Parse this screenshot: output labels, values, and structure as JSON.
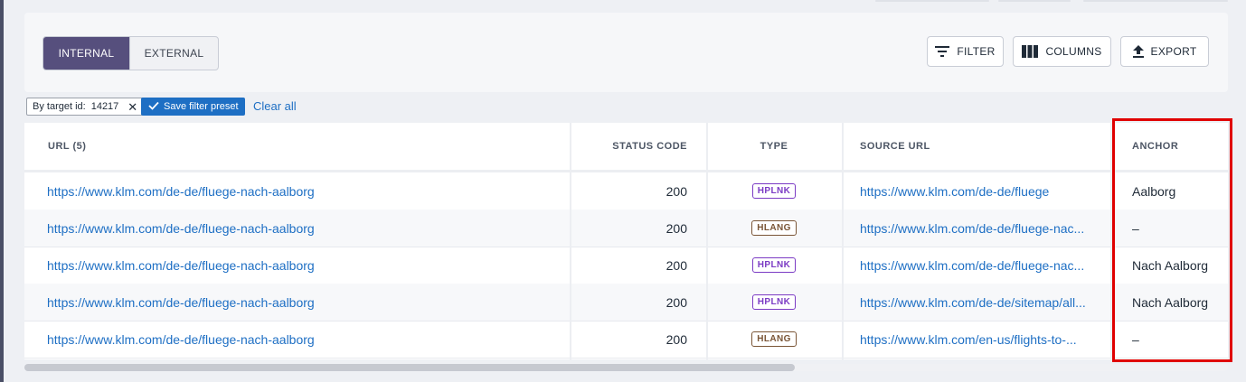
{
  "tabs": [
    {
      "label": "INTERNAL",
      "active": true
    },
    {
      "label": "EXTERNAL",
      "active": false
    }
  ],
  "toolbar": {
    "filter_label": "FILTER",
    "columns_label": "COLUMNS",
    "export_label": "EXPORT",
    "icons": [
      "filter-icon",
      "columns-icon",
      "export-icon"
    ]
  },
  "filters": {
    "chip_label": "By target id:",
    "chip_value": "14217",
    "save_preset_label": "Save filter preset",
    "clear_all_label": "Clear all"
  },
  "table": {
    "columns": [
      "URL (5)",
      "STATUS CODE",
      "TYPE",
      "SOURCE URL",
      "ANCHOR"
    ],
    "rows": [
      {
        "url": "https://www.klm.com/de-de/fluege-nach-aalborg",
        "status": "200",
        "type": "HPLNK",
        "source": "https://www.klm.com/de-de/fluege",
        "anchor": "Aalborg"
      },
      {
        "url": "https://www.klm.com/de-de/fluege-nach-aalborg",
        "status": "200",
        "type": "HLANG",
        "source": "https://www.klm.com/de-de/fluege-nac...",
        "anchor": "–"
      },
      {
        "url": "https://www.klm.com/de-de/fluege-nach-aalborg",
        "status": "200",
        "type": "HPLNK",
        "source": "https://www.klm.com/de-de/fluege-nac...",
        "anchor": "Nach Aalborg"
      },
      {
        "url": "https://www.klm.com/de-de/fluege-nach-aalborg",
        "status": "200",
        "type": "HPLNK",
        "source": "https://www.klm.com/de-de/sitemap/all...",
        "anchor": "Nach Aalborg"
      },
      {
        "url": "https://www.klm.com/de-de/fluege-nach-aalborg",
        "status": "200",
        "type": "HLANG",
        "source": "https://www.klm.com/en-us/flights-to-...",
        "anchor": "–"
      }
    ]
  },
  "colors": {
    "accent": "#564f7d",
    "link": "#1e6fc4",
    "hplnk_badge": "#7b3bc4",
    "hlang_badge": "#7a5536",
    "highlight": "#e00000"
  }
}
